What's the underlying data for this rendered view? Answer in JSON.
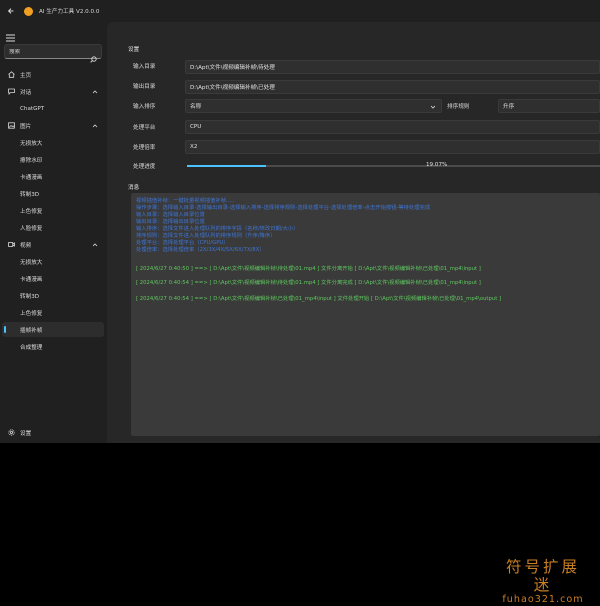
{
  "window": {
    "title": "AI 生产力工具 V2.0.0.0"
  },
  "sidebar": {
    "search_placeholder": "搜索",
    "items": [
      {
        "label": "主页",
        "icon": "home-icon"
      },
      {
        "label": "对话",
        "icon": "chat-icon",
        "expanded": true
      },
      {
        "label": "ChatGPT",
        "sub": true
      },
      {
        "label": "图片",
        "icon": "image-icon",
        "expanded": true
      },
      {
        "label": "无损放大",
        "sub": true
      },
      {
        "label": "擦除水印",
        "sub": true
      },
      {
        "label": "卡通漫画",
        "sub": true
      },
      {
        "label": "转制3D",
        "sub": true
      },
      {
        "label": "上色修复",
        "sub": true
      },
      {
        "label": "人脸修复",
        "sub": true
      },
      {
        "label": "视频",
        "icon": "video-icon",
        "expanded": true
      },
      {
        "label": "无损放大",
        "sub": true
      },
      {
        "label": "卡通漫画",
        "sub": true
      },
      {
        "label": "转制3D",
        "sub": true
      },
      {
        "label": "上色修复",
        "sub": true
      },
      {
        "label": "插帧补帧",
        "sub": true,
        "active": true
      },
      {
        "label": "合成整理",
        "sub": true
      }
    ],
    "settings_label": "设置"
  },
  "settings": {
    "title": "设置",
    "input_dir_label": "输入目录",
    "input_dir_value": "D:\\Apt\\文件\\视频编辑补帧\\待处理",
    "output_dir_label": "输出目录",
    "output_dir_value": "D:\\Apt\\文件\\视频编辑补帧\\已处理",
    "sort_label": "输入排序",
    "sort_value": "名称",
    "sort_rule_label": "排序规则",
    "sort_rule_value": "升序",
    "platform_label": "处理平台",
    "platform_value": "CPU",
    "rate_label": "处理倍率",
    "rate_value": "X2",
    "progress_label": "处理进度",
    "progress_value": 0.1907,
    "progress_text": "19.07%"
  },
  "messages": {
    "title": "消息",
    "intro": [
      "视频插值补帧：一键批量视频插值补帧.....",
      "操作步骤：选择输入目录-选择输出目录-选择输入排序-选择排序规则-选择处理平台-选择处理倍率-点击开始按钮-等待处理完成",
      "输入目录：选择输入目录位置",
      "输出目录：选择输出目录位置",
      "输入排序：选择文件进入处理队列的排序字段（名称/修改日期/大小）",
      "排序规则：选择文件进入处理队列的排序规则（升序/降序）",
      "处理平台：选择处理平台（CPU/GPU）",
      "处理倍率：选择处理倍率（2X/3X/4X/5X/6X/7X/8X）"
    ],
    "logs": [
      "[ 2024/6/27 0:40:50 ] ==> [ D:\\Apt\\文件\\视频编辑补帧\\待处理\\01.mp4 ] 文件分离开始 [ D:\\Apt\\文件\\视频编辑补帧\\已处理\\01_mp4\\input ]",
      "[ 2024/6/27 0:40:54 ] ==> [ D:\\Apt\\文件\\视频编辑补帧\\待处理\\01.mp4 ] 文件分离完成 [ D:\\Apt\\文件\\视频编辑补帧\\已处理\\01_mp4\\input ]",
      "[ 2024/6/27 0:40:54 ] ==> [ D:\\Apt\\文件\\视频编辑补帧\\已处理\\01_mp4\\input ] 文件处理开始 [ D:\\Apt\\文件\\视频编辑补帧\\已处理\\01_mp4\\output ]"
    ]
  },
  "watermark": {
    "cn": "符号扩展迷",
    "en": "fuhao321.com"
  },
  "colors": {
    "accent": "#4cc2ff",
    "intro_text": "#3e76d8",
    "log_text": "#5fc85f",
    "watermark": "#c97f24"
  }
}
